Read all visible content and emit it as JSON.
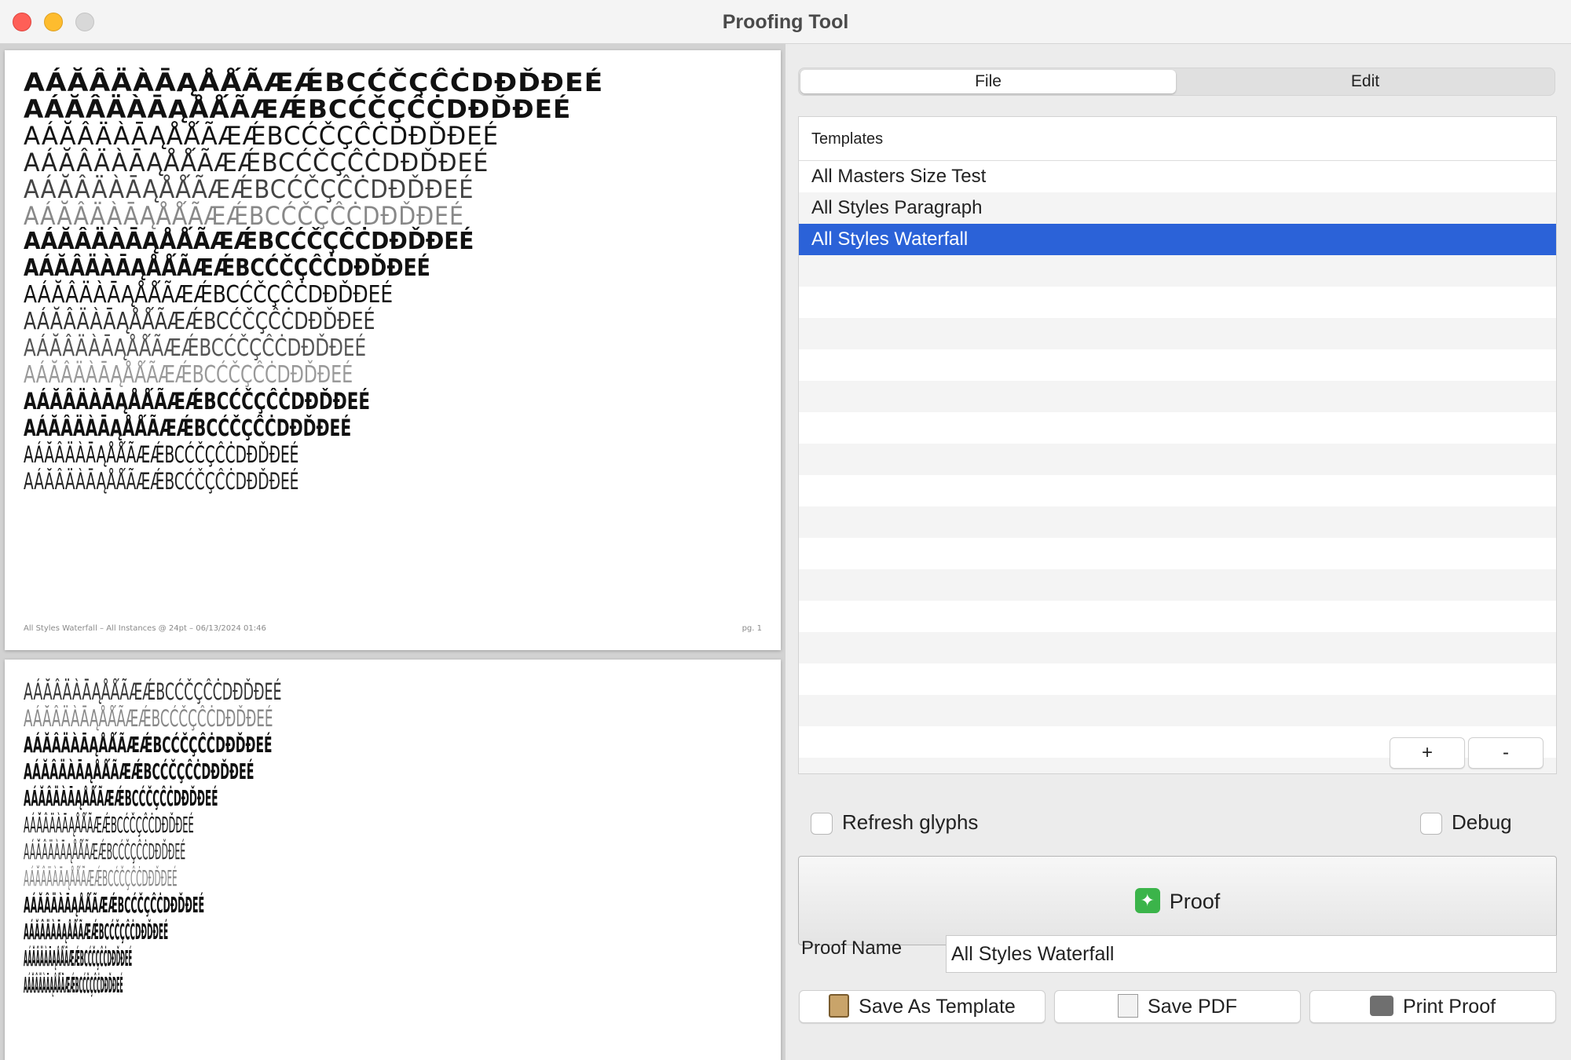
{
  "window": {
    "title": "Proofing Tool"
  },
  "preview": {
    "glyph_string": "AÁĂÂÄÀĀĄÅǺÃÆǼBCĆČÇĈĊDĐĎĐEÉ",
    "page1": {
      "footer_left": "All Styles Waterfall – All Instances @ 24pt – 06/13/2024 01:46",
      "footer_right": "pg. 1"
    }
  },
  "tabs": {
    "file": "File",
    "edit": "Edit"
  },
  "templates": {
    "header": "Templates",
    "items": [
      "All Masters Size Test",
      "All Styles Paragraph",
      "All Styles Waterfall"
    ],
    "selected_index": 2,
    "add_label": "+",
    "remove_label": "-"
  },
  "options": {
    "refresh_glyphs": {
      "label": "Refresh glyphs",
      "checked": false
    },
    "debug": {
      "label": "Debug",
      "checked": false
    }
  },
  "proof_button": {
    "label": "Proof",
    "icon": "sparkle-icon"
  },
  "proof_name": {
    "label": "Proof Name",
    "value": "All Styles Waterfall"
  },
  "actions": {
    "save_template": "Save As Template",
    "save_pdf": "Save PDF",
    "print_proof": "Print Proof"
  }
}
